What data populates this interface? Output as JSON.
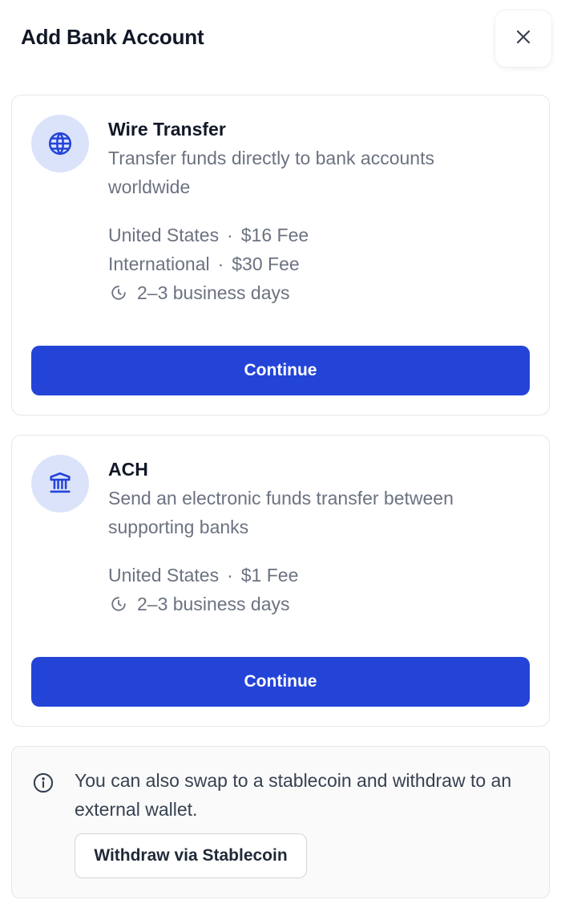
{
  "header": {
    "title": "Add Bank Account",
    "close_icon": "close-icon"
  },
  "methods": [
    {
      "title": "Wire Transfer",
      "icon": "globe-icon",
      "description": "Transfer funds directly to bank accounts worldwide",
      "fees": [
        {
          "region": "United States",
          "separator": "·",
          "fee": "$16 Fee"
        },
        {
          "region": "International",
          "separator": "·",
          "fee": "$30 Fee"
        }
      ],
      "timing": "2–3 business days",
      "button_label": "Continue"
    },
    {
      "title": "ACH",
      "icon": "bank-icon",
      "description": "Send an electronic funds transfer between supporting banks",
      "fees": [
        {
          "region": "United States",
          "separator": "·",
          "fee": "$1 Fee"
        }
      ],
      "timing": "2–3 business days",
      "button_label": "Continue"
    }
  ],
  "info": {
    "icon": "info-icon",
    "text": "You can also swap to a stablecoin and withdraw to an external wallet.",
    "button_label": "Withdraw via Stablecoin"
  },
  "colors": {
    "primary_button": "#2444d8",
    "icon_circle": "#dbe3fb",
    "icon_stroke": "#2444d8",
    "muted_text": "#6b7280"
  }
}
